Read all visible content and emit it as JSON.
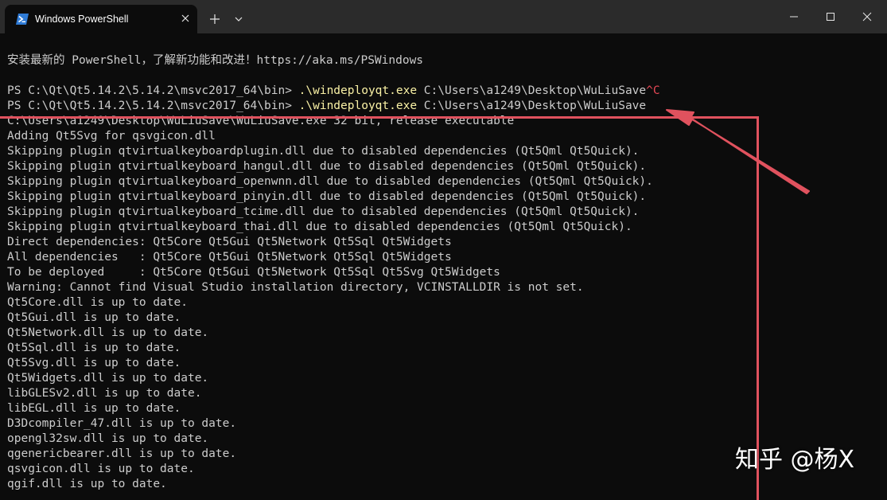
{
  "window": {
    "tab_title": "Windows PowerShell",
    "tab_icon": "powershell-icon",
    "buttons": [
      "close-icon",
      "plus-icon",
      "chevron-down-icon",
      "minimize-icon",
      "maximize-icon",
      "close-icon"
    ]
  },
  "terminal": {
    "banner": "安装最新的 PowerShell，了解新功能和改进！https://aka.ms/PSWindows",
    "prompt1": {
      "prompt": "PS C:\\Qt\\Qt5.14.2\\5.14.2\\msvc2017_64\\bin> ",
      "exe": ".\\windeployqt.exe",
      "args": " C:\\Users\\a1249\\Desktop\\WuLiuSave",
      "interrupt": "^C"
    },
    "prompt2": {
      "prompt": "PS C:\\Qt\\Qt5.14.2\\5.14.2\\msvc2017_64\\bin> ",
      "exe": ".\\windeployqt.exe",
      "args": " C:\\Users\\a1249\\Desktop\\WuLiuSave"
    },
    "output": [
      "C:\\Users\\a1249\\Desktop\\WuLiuSave\\WuLiuSave.exe 32 bit, release executable",
      "Adding Qt5Svg for qsvgicon.dll",
      "Skipping plugin qtvirtualkeyboardplugin.dll due to disabled dependencies (Qt5Qml Qt5Quick).",
      "Skipping plugin qtvirtualkeyboard_hangul.dll due to disabled dependencies (Qt5Qml Qt5Quick).",
      "Skipping plugin qtvirtualkeyboard_openwnn.dll due to disabled dependencies (Qt5Qml Qt5Quick).",
      "Skipping plugin qtvirtualkeyboard_pinyin.dll due to disabled dependencies (Qt5Qml Qt5Quick).",
      "Skipping plugin qtvirtualkeyboard_tcime.dll due to disabled dependencies (Qt5Qml Qt5Quick).",
      "Skipping plugin qtvirtualkeyboard_thai.dll due to disabled dependencies (Qt5Qml Qt5Quick).",
      "Direct dependencies: Qt5Core Qt5Gui Qt5Network Qt5Sql Qt5Widgets",
      "All dependencies   : Qt5Core Qt5Gui Qt5Network Qt5Sql Qt5Widgets",
      "To be deployed     : Qt5Core Qt5Gui Qt5Network Qt5Sql Qt5Svg Qt5Widgets",
      "Warning: Cannot find Visual Studio installation directory, VCINSTALLDIR is not set.",
      "Qt5Core.dll is up to date.",
      "Qt5Gui.dll is up to date.",
      "Qt5Network.dll is up to date.",
      "Qt5Sql.dll is up to date.",
      "Qt5Svg.dll is up to date.",
      "Qt5Widgets.dll is up to date.",
      "libGLESv2.dll is up to date.",
      "libEGL.dll is up to date.",
      "D3Dcompiler_47.dll is up to date.",
      "opengl32sw.dll is up to date.",
      "qgenericbearer.dll is up to date.",
      "qsvgicon.dll is up to date.",
      "qgif.dll is up to date."
    ]
  },
  "annotation": {
    "color": "#e0525e"
  },
  "watermark": "知乎 @杨X"
}
